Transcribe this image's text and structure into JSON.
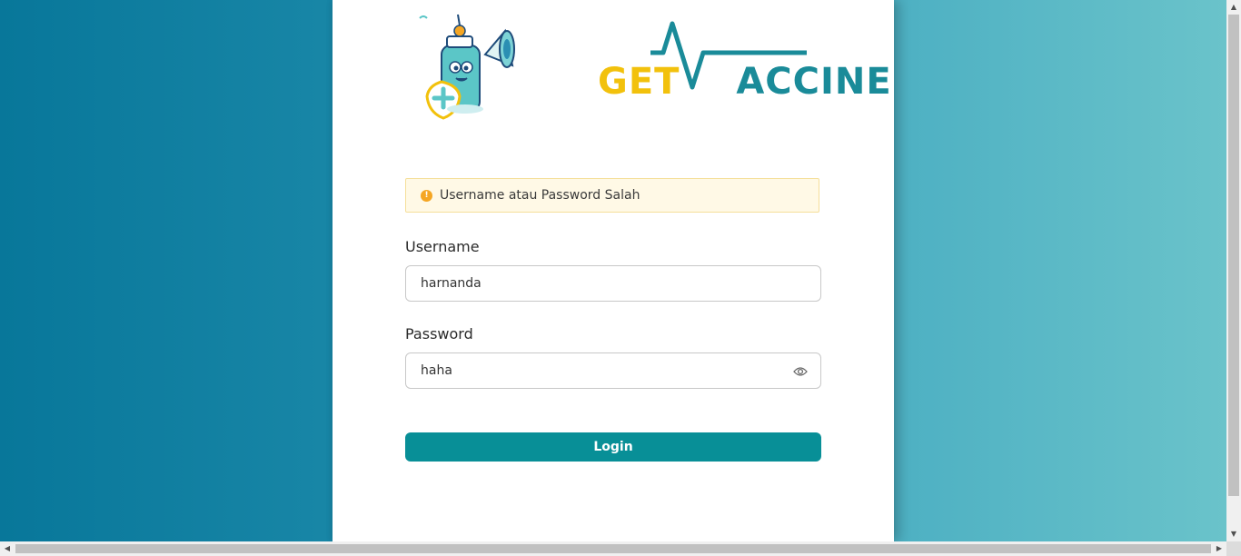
{
  "brand": {
    "logo_get": "GET",
    "logo_vaccine": "ACCINE",
    "logo_v": "V",
    "colors": {
      "get": "#f2c10c",
      "vaccine": "#1a8b99",
      "mascot": "#5bc6c7"
    }
  },
  "alert": {
    "icon": "warning-icon",
    "icon_glyph": "!",
    "message": "Username atau Password Salah"
  },
  "form": {
    "username_label": "Username",
    "username_value": "harnanda",
    "password_label": "Password",
    "password_value": "haha",
    "password_toggle_icon": "eye-icon",
    "login_label": "Login"
  },
  "theme": {
    "button_color": "#088f97",
    "background_gradient": [
      "#08779a",
      "#6ac3ca"
    ]
  },
  "scrollbars": {
    "up_arrow": "▲",
    "down_arrow": "▼",
    "left_arrow": "◀",
    "right_arrow": "▶"
  }
}
